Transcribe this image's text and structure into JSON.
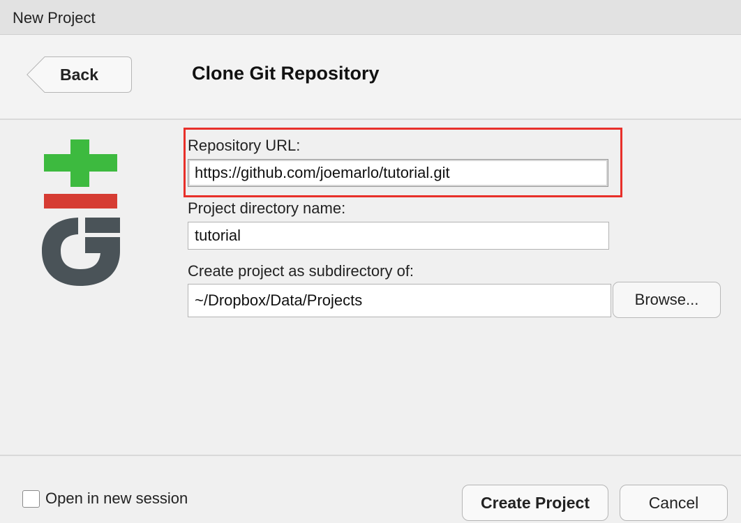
{
  "window": {
    "title": "New Project"
  },
  "header": {
    "back_label": "Back",
    "heading": "Clone Git Repository"
  },
  "logo": {
    "name": "git-logo-icon",
    "colors": {
      "plus": "#3dba3f",
      "minus": "#d63c33",
      "g": "#4a5358"
    }
  },
  "form": {
    "repo_url": {
      "label": "Repository URL:",
      "value": "https://github.com/joemarlo/tutorial.git"
    },
    "dir_name": {
      "label": "Project directory name:",
      "value": "tutorial"
    },
    "subdir": {
      "label": "Create project as subdirectory of:",
      "value": "~/Dropbox/Data/Projects",
      "browse_label": "Browse..."
    }
  },
  "footer": {
    "new_session_label": "Open in new session",
    "create_label": "Create Project",
    "cancel_label": "Cancel"
  },
  "highlight_color": "#e8302a"
}
